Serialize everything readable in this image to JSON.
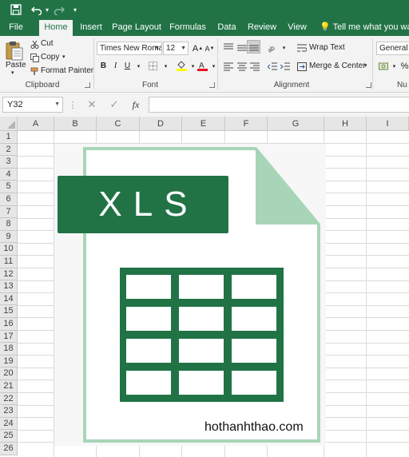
{
  "quick_access": {
    "save_icon": "save-icon",
    "undo_icon": "undo-icon",
    "redo_icon": "redo-icon"
  },
  "tabs": [
    {
      "label": "File"
    },
    {
      "label": "Home"
    },
    {
      "label": "Insert"
    },
    {
      "label": "Page Layout"
    },
    {
      "label": "Formulas"
    },
    {
      "label": "Data"
    },
    {
      "label": "Review"
    },
    {
      "label": "View"
    }
  ],
  "tell_me": "Tell me what you want to",
  "clipboard": {
    "paste": "Paste",
    "cut": "Cut",
    "copy": "Copy",
    "format_painter": "Format Painter",
    "group": "Clipboard"
  },
  "font": {
    "name": "Times New Roma",
    "size": "12",
    "bold": "B",
    "italic": "I",
    "underline": "U",
    "group": "Font"
  },
  "alignment": {
    "wrap_text": "Wrap Text",
    "merge_center": "Merge & Center",
    "group": "Alignment"
  },
  "number": {
    "format": "General",
    "percent": "%",
    "group": "Nu"
  },
  "formula_bar": {
    "name_box": "Y32",
    "fx": "fx",
    "formula": ""
  },
  "columns": [
    "A",
    "B",
    "C",
    "D",
    "E",
    "F",
    "G",
    "H",
    "I"
  ],
  "rows": [
    "1",
    "2",
    "3",
    "4",
    "5",
    "6",
    "7",
    "8",
    "9",
    "10",
    "11",
    "12",
    "13",
    "14",
    "15",
    "16",
    "17",
    "18",
    "19",
    "20",
    "21",
    "22",
    "23",
    "24",
    "25",
    "26"
  ],
  "logo": {
    "text": "XLS",
    "green": "#217346",
    "light_green": "#a8d5b8"
  },
  "watermark": "hothanhthao.com",
  "colors": {
    "excel_green": "#217346",
    "ribbon_bg": "#f3f3f3",
    "header_bg": "#e6e6e6"
  }
}
